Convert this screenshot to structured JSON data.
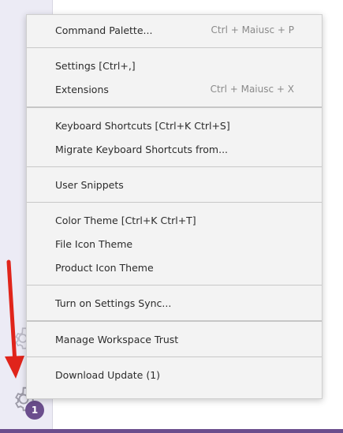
{
  "menu": {
    "groups": [
      [
        {
          "label": "Command Palette...",
          "shortcut": "Ctrl + Maiusc + P"
        }
      ],
      [
        {
          "label": "Settings [Ctrl+,]",
          "shortcut": ""
        },
        {
          "label": "Extensions",
          "shortcut": "Ctrl + Maiusc + X"
        }
      ],
      [
        {
          "label": "Keyboard Shortcuts [Ctrl+K Ctrl+S]",
          "shortcut": ""
        },
        {
          "label": "Migrate Keyboard Shortcuts from...",
          "shortcut": ""
        }
      ],
      [
        {
          "label": "User Snippets",
          "shortcut": ""
        }
      ],
      [
        {
          "label": "Color Theme [Ctrl+K Ctrl+T]",
          "shortcut": ""
        },
        {
          "label": "File Icon Theme",
          "shortcut": ""
        },
        {
          "label": "Product Icon Theme",
          "shortcut": ""
        }
      ],
      [
        {
          "label": "Turn on Settings Sync...",
          "shortcut": ""
        }
      ],
      [
        {
          "label": "Manage Workspace Trust",
          "shortcut": ""
        }
      ],
      [
        {
          "label": "Download Update (1)",
          "shortcut": ""
        }
      ]
    ]
  },
  "activity_bar": {
    "manage_badge": "1",
    "icons": [
      "accounts-icon",
      "manage-gear-icon"
    ]
  },
  "colors": {
    "menu_bg": "#f3f3f3",
    "activity_bg": "#ecebf5",
    "badge": "#6b4e8d",
    "arrow": "#e0241b"
  }
}
